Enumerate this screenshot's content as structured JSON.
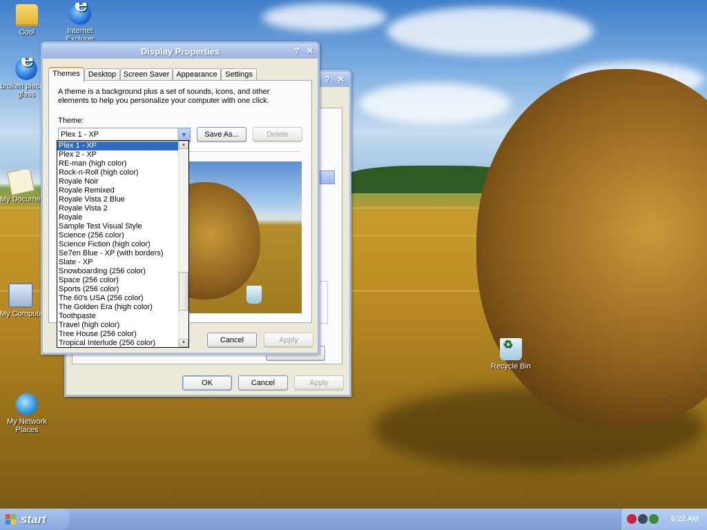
{
  "desktop": {
    "icons": [
      {
        "label": "Cool",
        "icon": "folder-icon"
      },
      {
        "label": "Internet Explorer",
        "icon": "internet-explorer-icon"
      },
      {
        "label": "broken piece of glass",
        "icon": "shortcut-ie-icon"
      },
      {
        "label": "My Documents",
        "icon": "my-documents-icon"
      },
      {
        "label": "My Computer",
        "icon": "my-computer-icon"
      },
      {
        "label": "My Network Places",
        "icon": "network-places-icon"
      },
      {
        "label": "Recycle Bin",
        "icon": "recycle-bin-icon"
      }
    ]
  },
  "back_window": {
    "help": "?",
    "close": "✕",
    "buttons": {
      "ok": "OK",
      "cancel": "Cancel",
      "apply": "Apply"
    }
  },
  "dialog": {
    "title": "Display Properties",
    "help": "?",
    "close": "✕",
    "tabs": [
      "Themes",
      "Desktop",
      "Screen Saver",
      "Appearance",
      "Settings"
    ],
    "active_tab": "Themes",
    "description": "A theme is a background plus a set of sounds, icons, and other elements to help you personalize your computer with one click.",
    "theme_label": "Theme:",
    "theme_value": "Plex 1 - XP",
    "save_as": "Save As...",
    "delete": "Delete",
    "buttons": {
      "cancel": "Cancel",
      "apply": "Apply"
    }
  },
  "theme_list": [
    "Plex 1 - XP",
    "Plex 2 - XP",
    "RE-man (high color)",
    "Rock-n-Roll (high color)",
    "Royale Noir",
    "Royale Remixed",
    "Royale Vista 2 Blue",
    "Royale Vista 2",
    "Royale",
    "Sample Test Visual Style",
    "Science (256 color)",
    "Science Fiction (high color)",
    "Se7en Blue - XP (with borders)",
    "Slate - XP",
    "Snowboarding (256 color)",
    "Space (256 color)",
    "Sports (256 color)",
    "The 60's USA (256 color)",
    "The Golden Era (high color)",
    "Toothpaste",
    "Travel (high color)",
    "Tree House (256 color)",
    "Tropical Interlude (256 color)"
  ],
  "theme_list_selected_index": 0,
  "taskbar": {
    "start_label": "start",
    "clock": "6:22 AM"
  }
}
